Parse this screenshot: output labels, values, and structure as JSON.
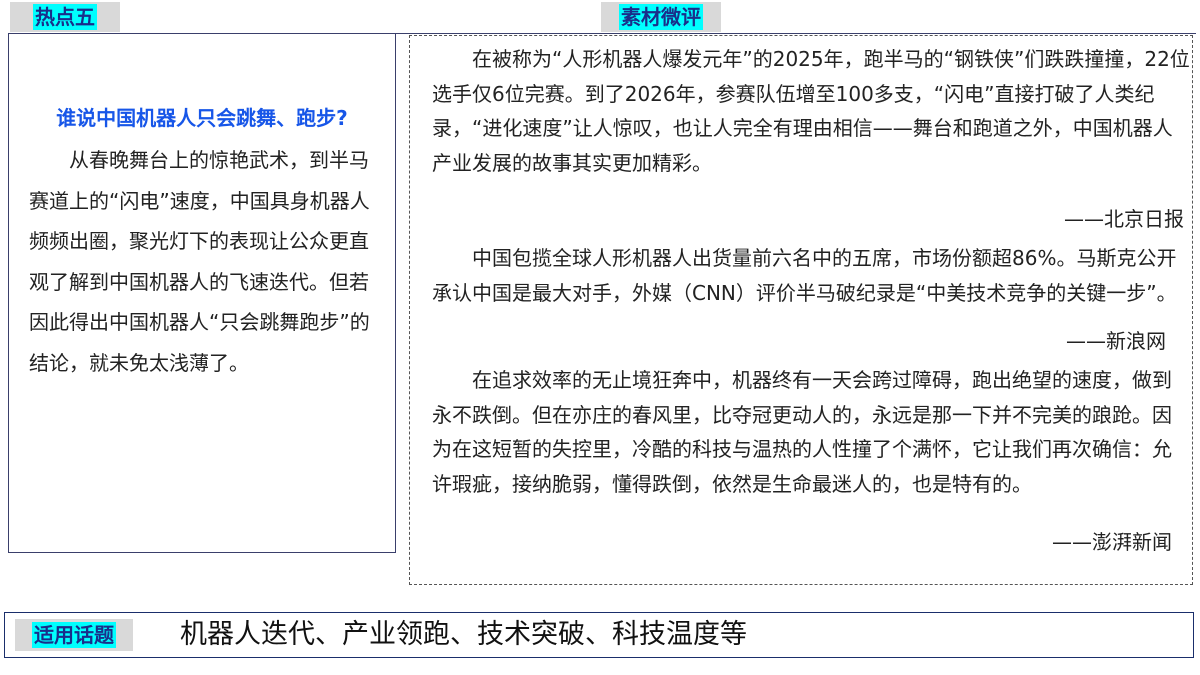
{
  "tags": {
    "left": "热点五",
    "right": "素材微评",
    "bottom": "适用话题"
  },
  "left_panel": {
    "heading": "谁说中国机器人只会跳舞、跑步?",
    "body": "从春晚舞台上的惊艳武术，到半马赛道上的“闪电”速度，中国具身机器人频频出圈，聚光灯下的表现让公众更直观了解到中国机器人的飞速迭代。但若因此得出中国机器人“只会跳舞跑步”的结论，就未免太浅薄了。"
  },
  "right_panel": {
    "para1": "在被称为“人形机器人爆发元年”的2025年，跑半马的“钢铁侠”们跌跌撞撞，22位选手仅6位完赛。到了2026年，参赛队伍增至100多支，“闪电”直接打破了人类纪录，“进化速度”让人惊叹，也让人完全有理由相信——舞台和跑道之外，中国机器人产业发展的故事其实更加精彩。",
    "source1": "——北京日报",
    "para2": "中国包揽全球人形机器人出货量前六名中的五席，市场份额超86%。马斯克公开承认中国是最大对手，外媒（CNN）评价半马破纪录是“中美技术竞争的关键一步”。",
    "source2": "——新浪网",
    "para3": "在追求效率的无止境狂奔中，机器终有一天会跨过障碍，跑出绝望的速度，做到永不跌倒。但在亦庄的春风里，比夺冠更动人的，永远是那一下并不完美的踉跄。因为在这短暂的失控里，冷酷的科技与温热的人性撞了个满怀，它让我们再次确信：允许瑕疵，接纳脆弱，懂得跌倒，依然是生命最迷人的，也是特有的。",
    "source3": "——澎湃新闻"
  },
  "bottom": {
    "topics": "机器人迭代、产业领跑、技术突破、科技温度等"
  },
  "colors": {
    "tag_highlight": "#00ffff",
    "tag_text": "#1a2e8a",
    "heading": "#1756e8",
    "border": "#3a3f6b"
  }
}
